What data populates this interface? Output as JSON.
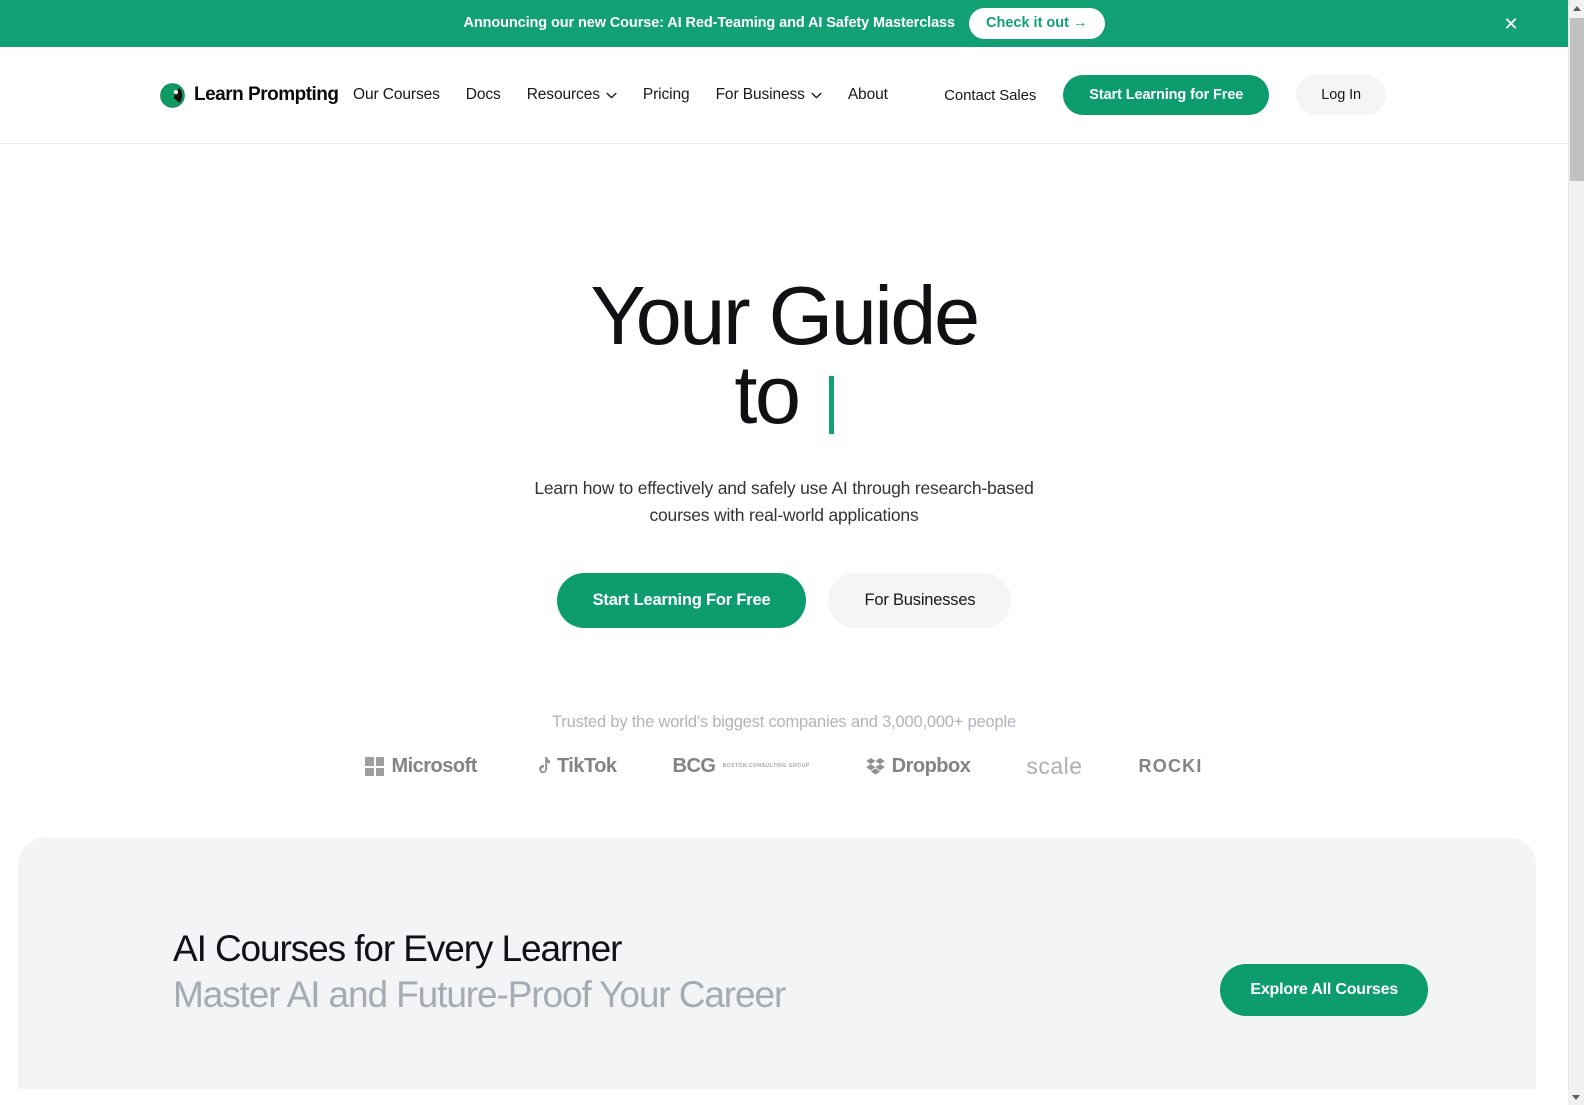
{
  "banner": {
    "message": "Announcing our new Course: AI Red-Teaming and AI Safety Masterclass",
    "cta_label": "Check it out →",
    "close_label": "✕",
    "background_color": "#12A075"
  },
  "header": {
    "brand_name": "Learn Prompting",
    "nav_items": [
      {
        "label": "Our Courses",
        "has_dropdown": false
      },
      {
        "label": "Docs",
        "has_dropdown": false
      },
      {
        "label": "Resources",
        "has_dropdown": true
      },
      {
        "label": "Pricing",
        "has_dropdown": false
      },
      {
        "label": "For Business",
        "has_dropdown": true
      },
      {
        "label": "About",
        "has_dropdown": false
      }
    ],
    "contact_label": "Contact Sales",
    "primary_cta_label": "Start Learning for Free",
    "login_label": "Log In"
  },
  "hero": {
    "title_line1": "Your Guide",
    "title_line2": "to",
    "typed_text": "",
    "subtitle": "Learn how to effectively and safely use AI through research-based courses with real-world applications",
    "primary_cta": "Start Learning For Free",
    "secondary_cta": "For Businesses",
    "accent_color": "#12A075"
  },
  "trusted": {
    "label": "Trusted by the world's biggest companies and 3,000,000+ people",
    "logos": [
      {
        "name": "Microsoft",
        "text": "Microsoft",
        "style": "bold"
      },
      {
        "name": "TikTok",
        "text": "TikTok",
        "style": "bold"
      },
      {
        "name": "BCG",
        "text": "BCG",
        "sub": "BOSTON CONSULTING GROUP",
        "style": "bold"
      },
      {
        "name": "Dropbox",
        "text": "Dropbox",
        "style": "bold"
      },
      {
        "name": "Scale",
        "text": "scale",
        "style": "thin"
      },
      {
        "name": "ROCKI",
        "text": "ROCKI",
        "style": "wide"
      }
    ]
  },
  "courses_section": {
    "title": "AI Courses for Every Learner",
    "subtitle": "Master AI and Future-Proof Your Career",
    "explore_label": "Explore All Courses",
    "background_color": "#F2F4F5"
  },
  "scrollbar": {
    "up_arrow": "▲",
    "down_arrow": "▼"
  }
}
